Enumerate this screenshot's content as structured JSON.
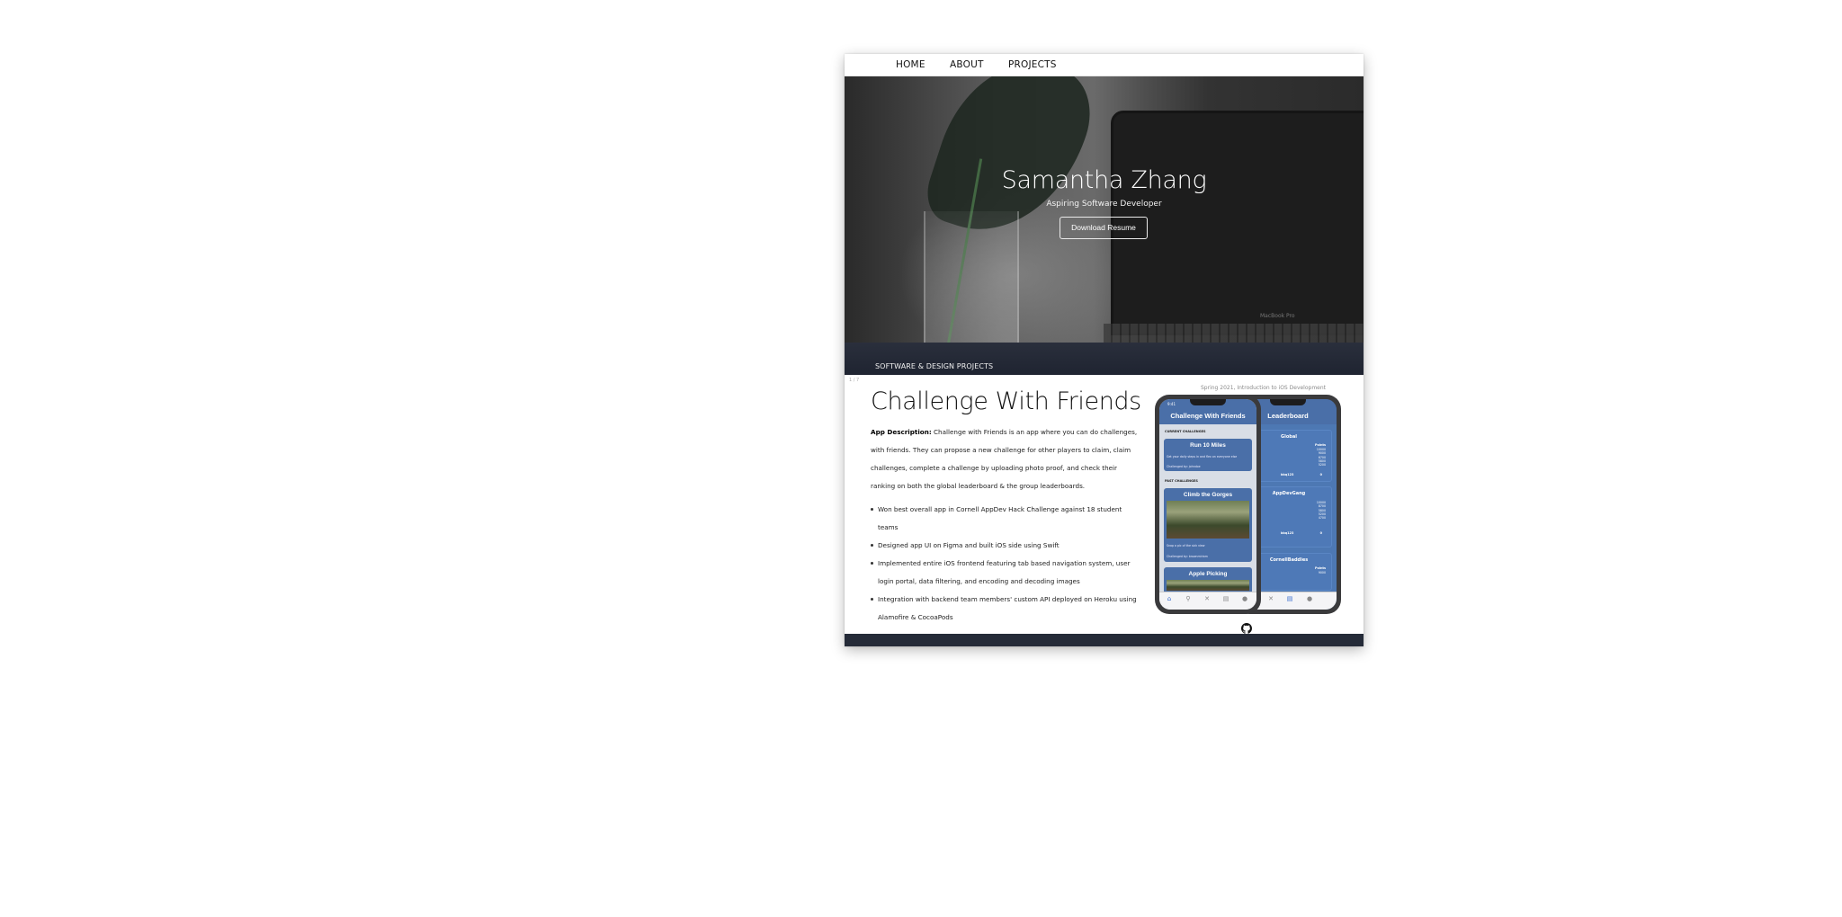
{
  "nav": {
    "home": "HOME",
    "about": "ABOUT",
    "projects": "PROJECTS"
  },
  "hero": {
    "title": "Samantha Zhang",
    "subtitle": "Aspiring Software Developer",
    "button": "Download Resume",
    "laptop_label": "MacBook Pro"
  },
  "projects_section": {
    "label": "SOFTWARE & DESIGN PROJECTS"
  },
  "project": {
    "counter": "1 / 7",
    "course": "Spring 2021, Introduction to iOS Development",
    "title": "Challenge With Friends",
    "desc_label": "App Description:",
    "desc_text": " Challenge with Friends is an app where you can do challenges, with friends. They can propose a new challenge for other players to claim, claim challenges, complete a challenge by uploading photo proof, and check their ranking on both the global leaderboard & the group leaderboards.",
    "bullets": [
      "Won best overall app in Cornell AppDev Hack Challenge against 18 student teams",
      "Designed app UI on Figma and built iOS side using Swift",
      "Implemented entire iOS frontend featuring tab based navigation system, user login portal, data filtering, and encoding and decoding images",
      "Integration with backend team members' custom API deployed on Heroku using Alamofire & CocoaPods"
    ]
  },
  "phone_front": {
    "time": "9:41",
    "title": "Challenge With Friends",
    "current_label": "CURRENT CHALLENGES",
    "card1_title": "Run 10 Miles",
    "card1_desc": "Get your daily steps in and flex on everyone else",
    "card1_by": "Challenged by: johndoe",
    "past_label": "PAST CHALLENGES",
    "card2_title": "Climb the Gorges",
    "card2_desc": "Snap a pic of the sick view",
    "card2_by": "Challenged by: brownmiriam",
    "card3_title": "Apple Picking"
  },
  "phone_back": {
    "title": "Leaderboard",
    "global_title": "Global",
    "points_label": "Points",
    "global_values": [
      "10000",
      "9000",
      "6700",
      "5800",
      "5200"
    ],
    "global_user": "bbq123",
    "global_user_value": "0",
    "group1_title": "AppDevGang",
    "group1_values": [
      "10000",
      "8700",
      "5800",
      "5200",
      "4700"
    ],
    "group1_user": "bbq123",
    "group1_user_value": "0",
    "group2_title": "CornellBaddies",
    "group2_values": [
      "9000"
    ]
  },
  "footer": {
    "dot_count": 7,
    "active_index": 0
  },
  "icons": {
    "github": "github-icon",
    "tabs": [
      "home-icon",
      "search-icon",
      "challenge-icon",
      "leaderboard-icon",
      "profile-icon"
    ]
  },
  "colors": {
    "accent_blue": "#4a6fa8",
    "dark_bar": "#252b38"
  }
}
